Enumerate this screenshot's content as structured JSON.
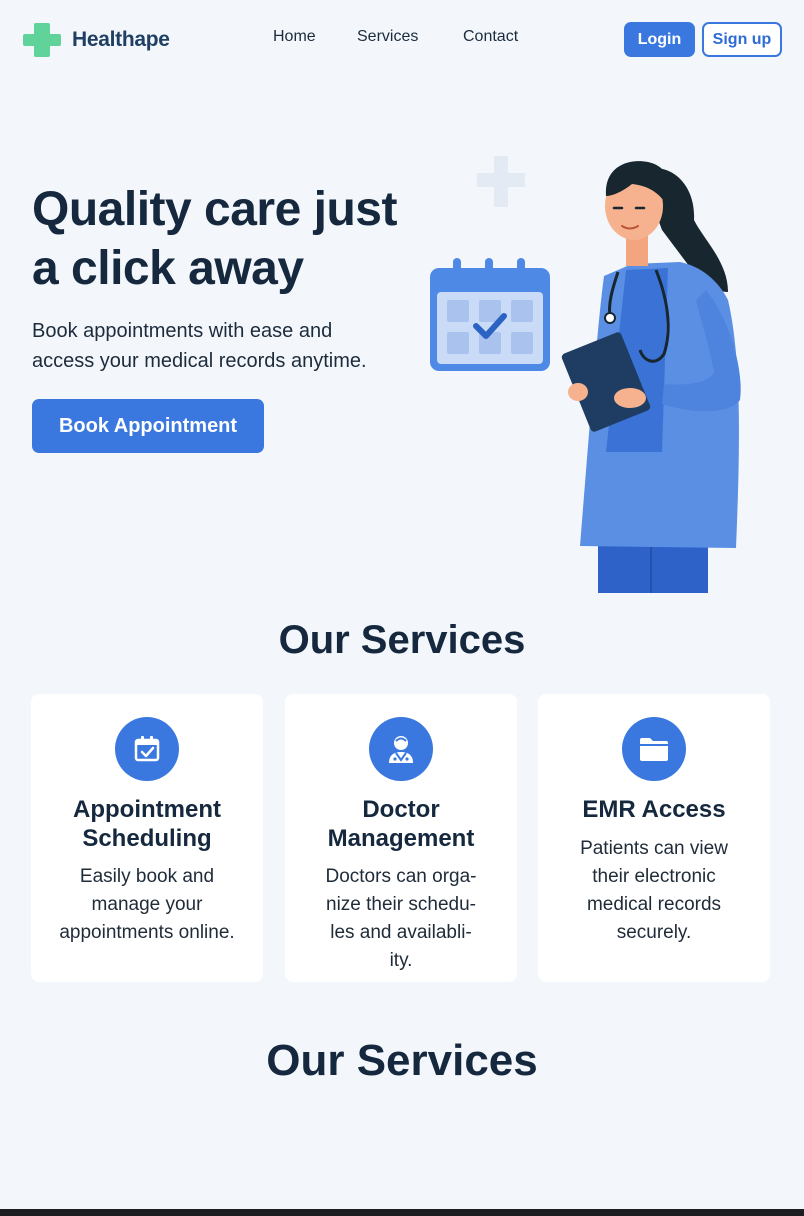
{
  "header": {
    "brand": "Healthape",
    "nav": [
      "Home",
      "Services",
      "Contact"
    ],
    "login_label": "Login",
    "signup_label": "Sign up"
  },
  "hero": {
    "title_line1": "Quality care just",
    "title_line2": "a click away",
    "subtitle_line1": "Book appointments with ease and",
    "subtitle_line2": "access your medical records anytime.",
    "cta_label": "Book Appointment"
  },
  "services": {
    "title": "Our Services",
    "cards": [
      {
        "icon": "calendar-check-icon",
        "title_line1": "Appointment",
        "title_line2": "Scheduling",
        "desc": [
          "Easily book and",
          "manage your",
          "appointments online."
        ]
      },
      {
        "icon": "doctor-icon",
        "title_line1": "Doctor",
        "title_line2": "Management",
        "desc": [
          "Doctors can orga-",
          "nize their schedu-",
          "les and availabli-",
          "ity."
        ]
      },
      {
        "icon": "folder-icon",
        "title_line1": "EMR Access",
        "title_line2": "",
        "desc": [
          "Patients can view",
          "their electronic",
          "medical records",
          "securely."
        ]
      }
    ]
  },
  "services_repeat": {
    "title": "Our Services"
  },
  "colors": {
    "accent": "#3a78e0",
    "logo_green": "#5fd39a",
    "heading": "#15283e",
    "background": "#f3f7fc"
  }
}
